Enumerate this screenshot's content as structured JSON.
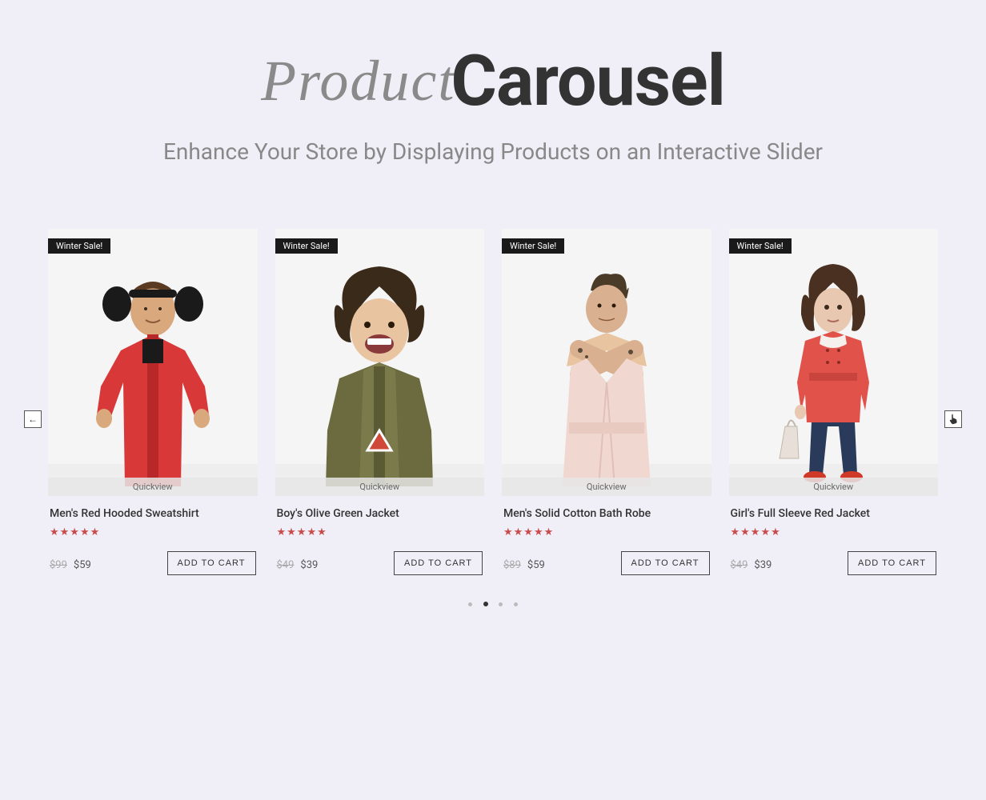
{
  "heading": {
    "script": "Product",
    "bold": "Carousel"
  },
  "subtitle": "Enhance Your Store by Displaying Products on an Interactive Slider",
  "sale_badge": "Winter Sale!",
  "quickview": "Quickview",
  "add_to_cart": "ADD TO CART",
  "products": [
    {
      "title": "Men's Red Hooded Sweatshirt",
      "old": "$99",
      "new": "$59"
    },
    {
      "title": "Boy's Olive Green Jacket",
      "old": "$49",
      "new": "$39"
    },
    {
      "title": "Men's Solid Cotton Bath Robe",
      "old": "$89",
      "new": "$59"
    },
    {
      "title": "Girl's Full Sleeve Red Jacket",
      "old": "$49",
      "new": "$39"
    }
  ],
  "carousel": {
    "dots": 4,
    "active_dot": 1
  }
}
